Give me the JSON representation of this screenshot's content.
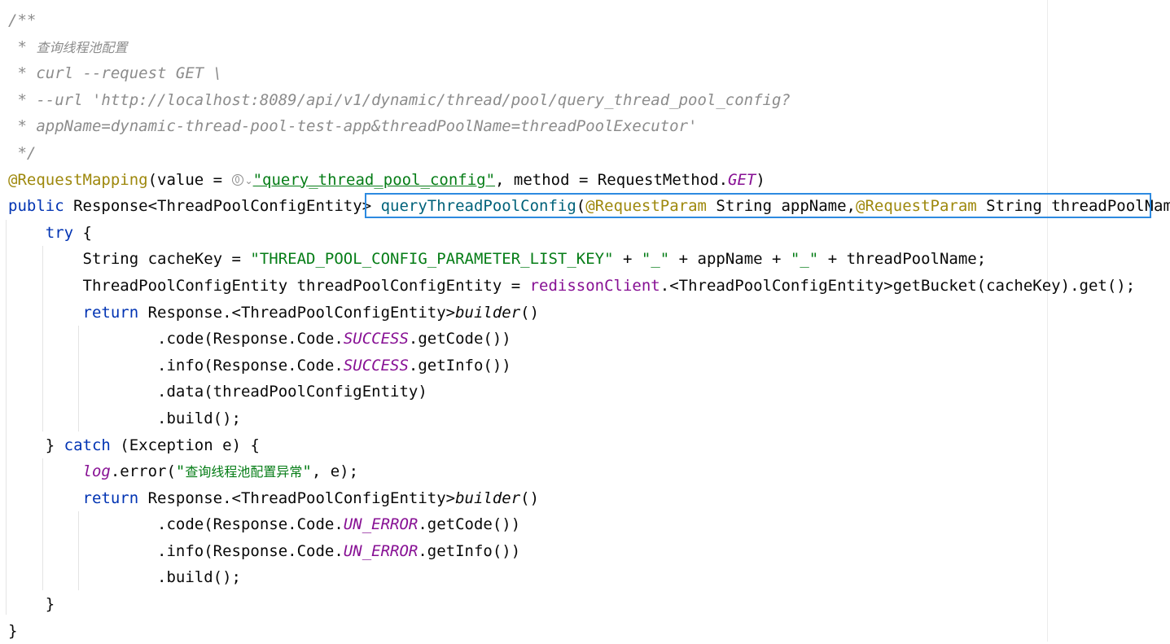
{
  "editor": {
    "lines": [
      {
        "indent": "",
        "tokens": [
          {
            "t": "/**",
            "c": "comment"
          }
        ]
      },
      {
        "indent": "",
        "tokens": [
          {
            "t": " * ",
            "c": "comment"
          },
          {
            "t": "查询线程池配置",
            "c": "comment cjk"
          }
        ]
      },
      {
        "indent": "",
        "tokens": [
          {
            "t": " * curl --request GET \\",
            "c": "comment"
          }
        ]
      },
      {
        "indent": "",
        "tokens": [
          {
            "t": " * --url 'http://localhost:8089/api/v1/dynamic/thread/pool/query_thread_pool_config?",
            "c": "comment"
          }
        ]
      },
      {
        "indent": "",
        "tokens": [
          {
            "t": " * appName=dynamic-thread-pool-test-app&threadPoolName=threadPoolExecutor'",
            "c": "comment"
          }
        ]
      },
      {
        "indent": "",
        "tokens": [
          {
            "t": " */",
            "c": "comment"
          }
        ]
      },
      {
        "indent": "",
        "tokens": [
          {
            "t": "@RequestMapping",
            "c": "ann"
          },
          {
            "t": "(value = ",
            "c": ""
          },
          {
            "t": "",
            "c": "globe"
          },
          {
            "t": "\"query_thread_pool_config\"",
            "c": "str link"
          },
          {
            "t": ", method = RequestMethod.",
            "c": ""
          },
          {
            "t": "GET",
            "c": "static"
          },
          {
            "t": ")",
            "c": ""
          }
        ]
      },
      {
        "indent": "",
        "tokens": [
          {
            "t": "public",
            "c": "kw"
          },
          {
            "t": " Response<ThreadPoolConfigEntity> ",
            "c": ""
          },
          {
            "t": "queryThreadPoolConfig",
            "c": "method-decl"
          },
          {
            "t": "(",
            "c": ""
          },
          {
            "t": "@RequestParam",
            "c": "ann"
          },
          {
            "t": " String appName,",
            "c": ""
          },
          {
            "t": "@RequestParam",
            "c": "ann"
          },
          {
            "t": " String threadPoolName) {",
            "c": ""
          }
        ]
      },
      {
        "indent": "    ",
        "tokens": [
          {
            "t": "try",
            "c": "kw"
          },
          {
            "t": " {",
            "c": ""
          }
        ]
      },
      {
        "indent": "        ",
        "tokens": [
          {
            "t": "String cacheKey = ",
            "c": ""
          },
          {
            "t": "\"THREAD_POOL_CONFIG_PARAMETER_LIST_KEY\"",
            "c": "str"
          },
          {
            "t": " + ",
            "c": ""
          },
          {
            "t": "\"_\"",
            "c": "str"
          },
          {
            "t": " + appName + ",
            "c": ""
          },
          {
            "t": "\"_\"",
            "c": "str"
          },
          {
            "t": " + threadPoolName;",
            "c": ""
          }
        ]
      },
      {
        "indent": "        ",
        "tokens": [
          {
            "t": "ThreadPoolConfigEntity threadPoolConfigEntity = ",
            "c": ""
          },
          {
            "t": "redissonClient",
            "c": "field"
          },
          {
            "t": ".<ThreadPoolConfigEntity>getBucket(cacheKey).get();",
            "c": ""
          }
        ]
      },
      {
        "indent": "        ",
        "tokens": [
          {
            "t": "return",
            "c": "kw"
          },
          {
            "t": " Response.<ThreadPoolConfigEntity>",
            "c": ""
          },
          {
            "t": "builder",
            "c": "italic"
          },
          {
            "t": "()",
            "c": ""
          }
        ]
      },
      {
        "indent": "                ",
        "tokens": [
          {
            "t": ".code(Response.Code.",
            "c": ""
          },
          {
            "t": "SUCCESS",
            "c": "static"
          },
          {
            "t": ".getCode())",
            "c": ""
          }
        ]
      },
      {
        "indent": "                ",
        "tokens": [
          {
            "t": ".info(Response.Code.",
            "c": ""
          },
          {
            "t": "SUCCESS",
            "c": "static"
          },
          {
            "t": ".getInfo())",
            "c": ""
          }
        ]
      },
      {
        "indent": "                ",
        "tokens": [
          {
            "t": ".data(threadPoolConfigEntity)",
            "c": ""
          }
        ]
      },
      {
        "indent": "                ",
        "tokens": [
          {
            "t": ".build();",
            "c": ""
          }
        ]
      },
      {
        "indent": "    ",
        "tokens": [
          {
            "t": "} ",
            "c": ""
          },
          {
            "t": "catch",
            "c": "kw"
          },
          {
            "t": " (Exception e) {",
            "c": ""
          }
        ]
      },
      {
        "indent": "        ",
        "tokens": [
          {
            "t": "log",
            "c": "static"
          },
          {
            "t": ".error(",
            "c": ""
          },
          {
            "t": "\"",
            "c": "str"
          },
          {
            "t": "查询线程池配置异常",
            "c": "str cjk"
          },
          {
            "t": "\"",
            "c": "str"
          },
          {
            "t": ", e);",
            "c": ""
          }
        ]
      },
      {
        "indent": "        ",
        "tokens": [
          {
            "t": "return",
            "c": "kw"
          },
          {
            "t": " Response.<ThreadPoolConfigEntity>",
            "c": ""
          },
          {
            "t": "builder",
            "c": "italic"
          },
          {
            "t": "()",
            "c": ""
          }
        ]
      },
      {
        "indent": "                ",
        "tokens": [
          {
            "t": ".code(Response.Code.",
            "c": ""
          },
          {
            "t": "UN_ERROR",
            "c": "static"
          },
          {
            "t": ".getCode())",
            "c": ""
          }
        ]
      },
      {
        "indent": "                ",
        "tokens": [
          {
            "t": ".info(Response.Code.",
            "c": ""
          },
          {
            "t": "UN_ERROR",
            "c": "static"
          },
          {
            "t": ".getInfo())",
            "c": ""
          }
        ]
      },
      {
        "indent": "                ",
        "tokens": [
          {
            "t": ".build();",
            "c": ""
          }
        ]
      },
      {
        "indent": "    ",
        "tokens": [
          {
            "t": "}",
            "c": ""
          }
        ]
      },
      {
        "indent": "",
        "tokens": [
          {
            "t": "}",
            "c": ""
          }
        ]
      }
    ],
    "icons": {
      "url_inlay": "globe-icon",
      "url_inlay_dropdown": "chevron-down-icon"
    },
    "highlight": {
      "color": "#2d8ae0",
      "target": "queryThreadPoolConfig"
    },
    "colors": {
      "keyword": "#0033b3",
      "string": "#067d17",
      "annotation": "#9e880d",
      "comment": "#8c8c8c",
      "static_field": "#871094",
      "method_declaration": "#00627a"
    }
  }
}
